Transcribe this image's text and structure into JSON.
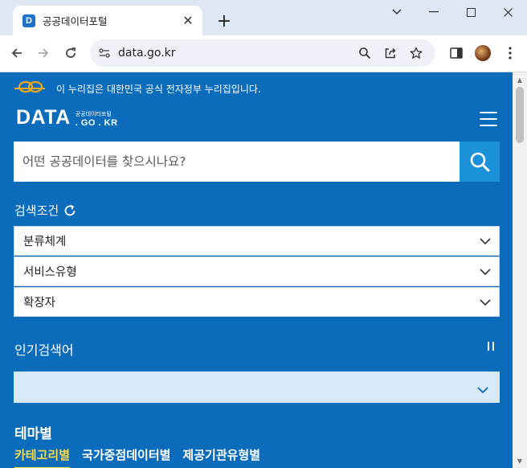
{
  "browser": {
    "tab_title": "공공데이터포털",
    "favicon_letter": "D",
    "url": "data.go.kr"
  },
  "page": {
    "gov_notice": "이 누리집은 대한민국 공식 전자정부 누리집입니다.",
    "logo": {
      "main": "DATA",
      "sub_top": "공공데이터포털",
      "sub_bottom": ". GO . KR"
    },
    "search": {
      "placeholder": "어떤 공공데이터를 찾으시나요?"
    },
    "search_conditions_label": "검색조건",
    "filters": [
      {
        "label": "분류체계"
      },
      {
        "label": "서비스유형"
      },
      {
        "label": "확장자"
      }
    ],
    "popular_label": "인기검색어",
    "theme": {
      "title": "테마별",
      "tabs": [
        "카테고리별",
        "국가중점데이터별",
        "제공기관유형별"
      ],
      "active_tab": 0
    }
  },
  "colors": {
    "page_bg": "#0a6cbb",
    "search_button": "#1a91d9",
    "active_tab": "#f7d94c",
    "popular_box": "#d9eaf7"
  }
}
